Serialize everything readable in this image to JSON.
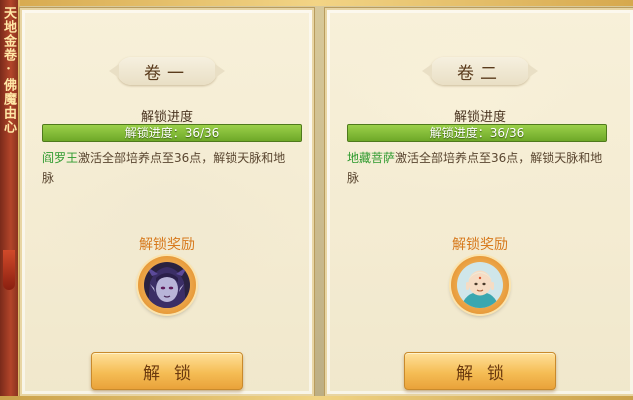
{
  "side_banner": {
    "text": "天地金卷·佛魔由心"
  },
  "scrolls": [
    {
      "title": "卷一",
      "progress_heading": "解锁进度",
      "progress_text": "解锁进度：36/36",
      "progress_current": 36,
      "progress_total": 36,
      "desc_name": "阎罗王",
      "desc_text": "激活全部培养点至36点，解锁天脉和地脉",
      "reward_heading": "解锁奖励",
      "portrait": "demon-king-portrait",
      "button_label": "解锁"
    },
    {
      "title": "卷二",
      "progress_heading": "解锁进度",
      "progress_text": "解锁进度：36/36",
      "progress_current": 36,
      "progress_total": 36,
      "desc_name": "地藏菩萨",
      "desc_text": "激活全部培养点至36点，解锁天脉和地脉",
      "reward_heading": "解锁奖励",
      "portrait": "bodhisattva-portrait",
      "button_label": "解锁"
    }
  ],
  "colors": {
    "name_green": "#2e9a2e",
    "reward_orange": "#d77a1e",
    "progress_green": "#7ea532",
    "button_gold": "#f5bd55"
  }
}
